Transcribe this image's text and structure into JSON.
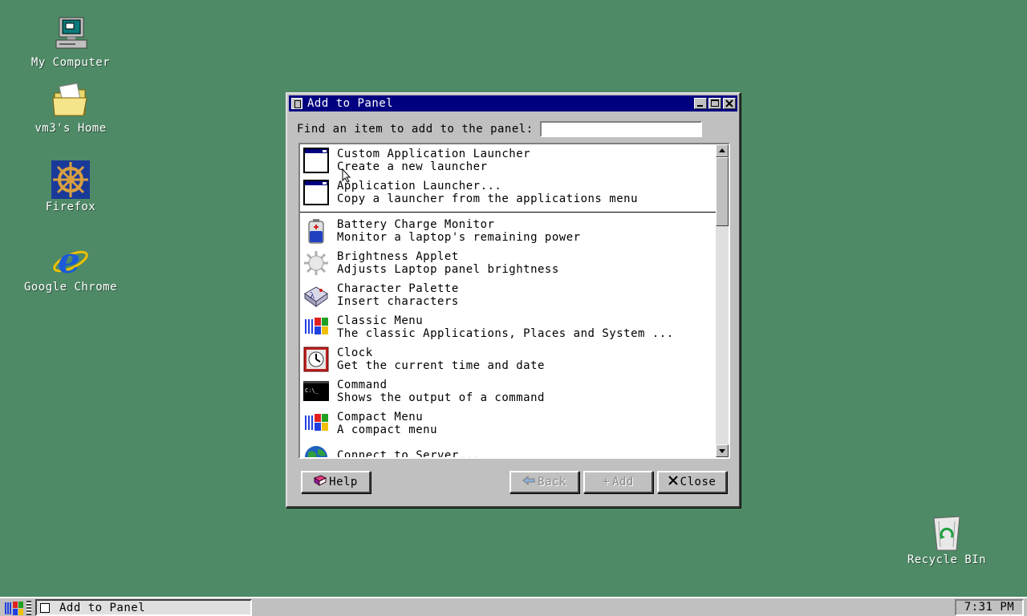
{
  "desktop": {
    "icons": [
      {
        "label": "My Computer",
        "icon": "computer-icon"
      },
      {
        "label": "vm3's Home",
        "icon": "folder-icon"
      },
      {
        "label": "Firefox",
        "icon": "ship-wheel-icon"
      },
      {
        "label": "Google Chrome",
        "icon": "internet-explorer-icon"
      },
      {
        "label": "Recycle BIn",
        "icon": "recycle-bin-icon"
      }
    ]
  },
  "window": {
    "title": "Add to Panel",
    "find_label": "Find an item to add to the panel:",
    "find_value": "",
    "items": [
      {
        "name": "Custom Application Launcher",
        "desc": "Create a new launcher",
        "icon": "launcher-window-icon"
      },
      {
        "name": "Application Launcher...",
        "desc": "Copy a launcher from the applications menu",
        "icon": "launcher-window-icon"
      },
      {
        "name": "Battery Charge Monitor",
        "desc": "Monitor a laptop's remaining power",
        "icon": "battery-icon"
      },
      {
        "name": "Brightness Applet",
        "desc": "Adjusts Laptop panel brightness",
        "icon": "brightness-sun-icon"
      },
      {
        "name": "Character Palette",
        "desc": "Insert characters",
        "icon": "character-palette-icon"
      },
      {
        "name": "Classic Menu",
        "desc": "The classic Applications, Places and System ...",
        "icon": "windows-flag-icon"
      },
      {
        "name": "Clock",
        "desc": "Get the current time and date",
        "icon": "clock-icon"
      },
      {
        "name": "Command",
        "desc": "Shows the output of a command",
        "icon": "terminal-icon"
      },
      {
        "name": "Compact Menu",
        "desc": "A compact menu",
        "icon": "windows-flag-icon"
      },
      {
        "name": "Connect to Server...",
        "desc": "",
        "icon": "globe-icon"
      }
    ],
    "buttons": {
      "help": "Help",
      "back": "Back",
      "add": "Add",
      "close": "Close"
    }
  },
  "taskbar": {
    "task_label": "Add to Panel",
    "clock": "7:31 PM"
  }
}
